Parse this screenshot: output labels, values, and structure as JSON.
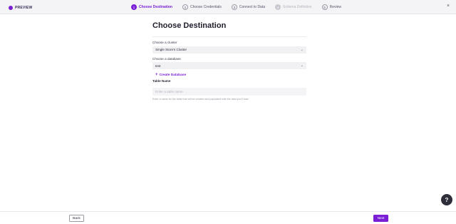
{
  "header": {
    "badge_label": "PREVIEW",
    "close_glyph": "×",
    "steps": [
      {
        "number": "1",
        "label": "Choose Destination",
        "state": "active"
      },
      {
        "number": "2",
        "label": "Choose Credentials",
        "state": "default"
      },
      {
        "number": "3",
        "label": "Connect to Data",
        "state": "default"
      },
      {
        "number": "4",
        "label": "Schema Definition",
        "state": "disabled"
      },
      {
        "number": "5",
        "label": "Review",
        "state": "default"
      }
    ]
  },
  "main": {
    "title": "Choose Destination",
    "cluster": {
      "label": "Choose a cluster",
      "value": "Single Store's Cluster"
    },
    "database": {
      "label": "Choose a database",
      "value": "test"
    },
    "create_database_label": "Create Database",
    "table_name": {
      "label": "Table Name",
      "placeholder": "Enter a table name",
      "value": ""
    },
    "helper_text": "Enter a name for the table that will be created and populated with the data you'll load"
  },
  "help_button_label": "?",
  "footer": {
    "back_label": "Back",
    "next_label": "Next"
  },
  "colors": {
    "accent": "#7a1fd6",
    "topbar": "#f4f4f6",
    "help_button": "#2e2e3a"
  }
}
